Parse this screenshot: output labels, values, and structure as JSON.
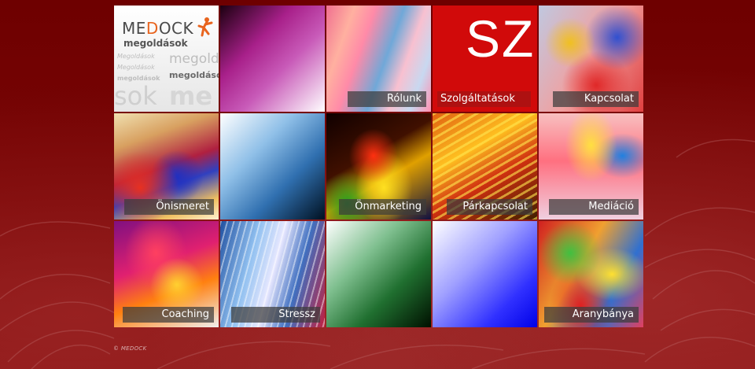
{
  "logo": {
    "brand_prefix": "ME",
    "brand_d": "D",
    "brand_suffix": "OCK",
    "subtitle": "megoldások",
    "bg_words": [
      "Megoldások",
      "megold",
      "megoldások",
      "megoldások",
      "Megoldások",
      "sok",
      "me"
    ]
  },
  "tiles": [
    {
      "id": "logo",
      "label": ""
    },
    {
      "id": "magenta",
      "label": ""
    },
    {
      "id": "rolunk",
      "label": "Rólunk"
    },
    {
      "id": "szolgaltatasok",
      "label": "Szolgáltatások",
      "big_text": "SZ"
    },
    {
      "id": "kapcsolat",
      "label": "Kapcsolat"
    },
    {
      "id": "onismeret",
      "label": "Önismeret"
    },
    {
      "id": "blue",
      "label": ""
    },
    {
      "id": "onmarketing",
      "label": "Önmarketing"
    },
    {
      "id": "parkapcsolat",
      "label": "Párkapcsolat"
    },
    {
      "id": "mediacio",
      "label": "Mediáció"
    },
    {
      "id": "coaching",
      "label": "Coaching"
    },
    {
      "id": "stressz",
      "label": "Stressz"
    },
    {
      "id": "green",
      "label": ""
    },
    {
      "id": "violet",
      "label": ""
    },
    {
      "id": "aranybanya",
      "label": "Aranybánya"
    }
  ],
  "footer": {
    "copyright": "© MEDOCK"
  },
  "colors": {
    "page_bg": "#7a0606",
    "label_bg": "#3c3c3c",
    "sz_red": "#d10a0a",
    "brand_orange": "#e8641e"
  }
}
